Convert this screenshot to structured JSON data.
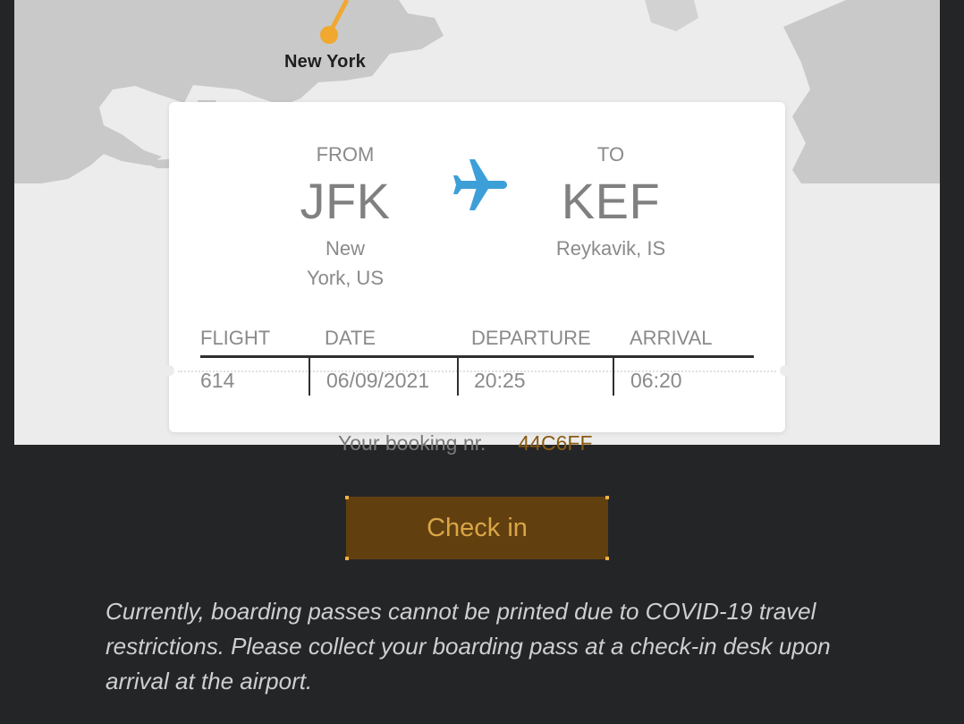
{
  "map": {
    "origin_city_label": "New York",
    "route_color": "#f0a830"
  },
  "card": {
    "from": {
      "label": "FROM",
      "code": "JFK",
      "city_line1": "New",
      "city_line2": "York, US"
    },
    "to": {
      "label": "TO",
      "code": "KEF",
      "city": "Reykavik, IS"
    },
    "plane_color": "#3d9fd8",
    "columns": [
      "FLIGHT",
      "DATE",
      "DEPARTURE",
      "ARRIVAL"
    ],
    "values": {
      "flight": "614",
      "date": "06/09/2021",
      "departure": "20:25",
      "arrival": "06:20"
    }
  },
  "booking": {
    "label": "Your booking nr.",
    "reference": "44C6FF"
  },
  "checkin_button": {
    "label": "Check in"
  },
  "notice": "Currently, boarding passes cannot be printed due to COVID-19 travel restrictions. Please collect your boarding pass at a check-in desk upon arrival at the airport."
}
